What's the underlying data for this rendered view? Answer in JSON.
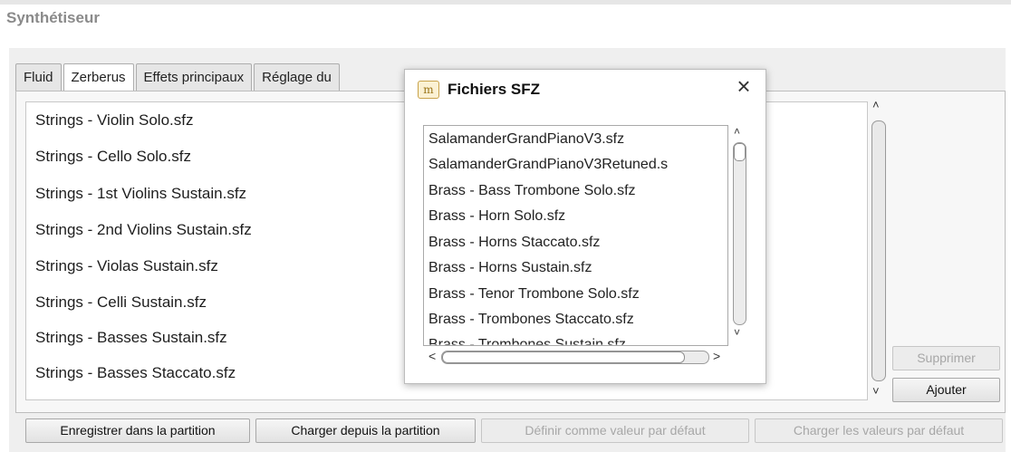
{
  "window": {
    "title": "Synthétiseur"
  },
  "tabs": [
    {
      "label": "Fluid"
    },
    {
      "label": "Zerberus"
    },
    {
      "label": "Effets principaux"
    },
    {
      "label": "Réglage du"
    }
  ],
  "loaded_list": [
    "Strings - Violin Solo.sfz",
    "Strings - Cello Solo.sfz",
    "Strings - 1st Violins Sustain.sfz",
    "Strings - 2nd Violins Sustain.sfz",
    "Strings - Violas Sustain.sfz",
    "Strings - Celli Sustain.sfz",
    "Strings - Basses Sustain.sfz",
    "Strings - Basses Staccato.sfz"
  ],
  "side_buttons": {
    "remove": "Supprimer",
    "add": "Ajouter"
  },
  "bottom_buttons": {
    "save": "Enregistrer dans la partition",
    "load": "Charger depuis la partition",
    "set_default": "Définir comme valeur par défaut",
    "load_default": "Charger les valeurs par défaut"
  },
  "dialog": {
    "icon_text": "m",
    "title": "Fichiers SFZ",
    "close_symbol": "×",
    "files": [
      "SalamanderGrandPianoV3.sfz",
      "SalamanderGrandPianoV3Retuned.s",
      "Brass - Bass Trombone Solo.sfz",
      "Brass - Horn Solo.sfz",
      "Brass - Horns Staccato.sfz",
      "Brass - Horns Sustain.sfz",
      "Brass - Tenor Trombone Solo.sfz",
      "Brass - Trombones Staccato.sfz",
      "Brass - Trombones Sustain.sfz"
    ]
  },
  "scroll_arrows": {
    "up": "˄",
    "down": "˅",
    "left": "<",
    "right": ">"
  }
}
